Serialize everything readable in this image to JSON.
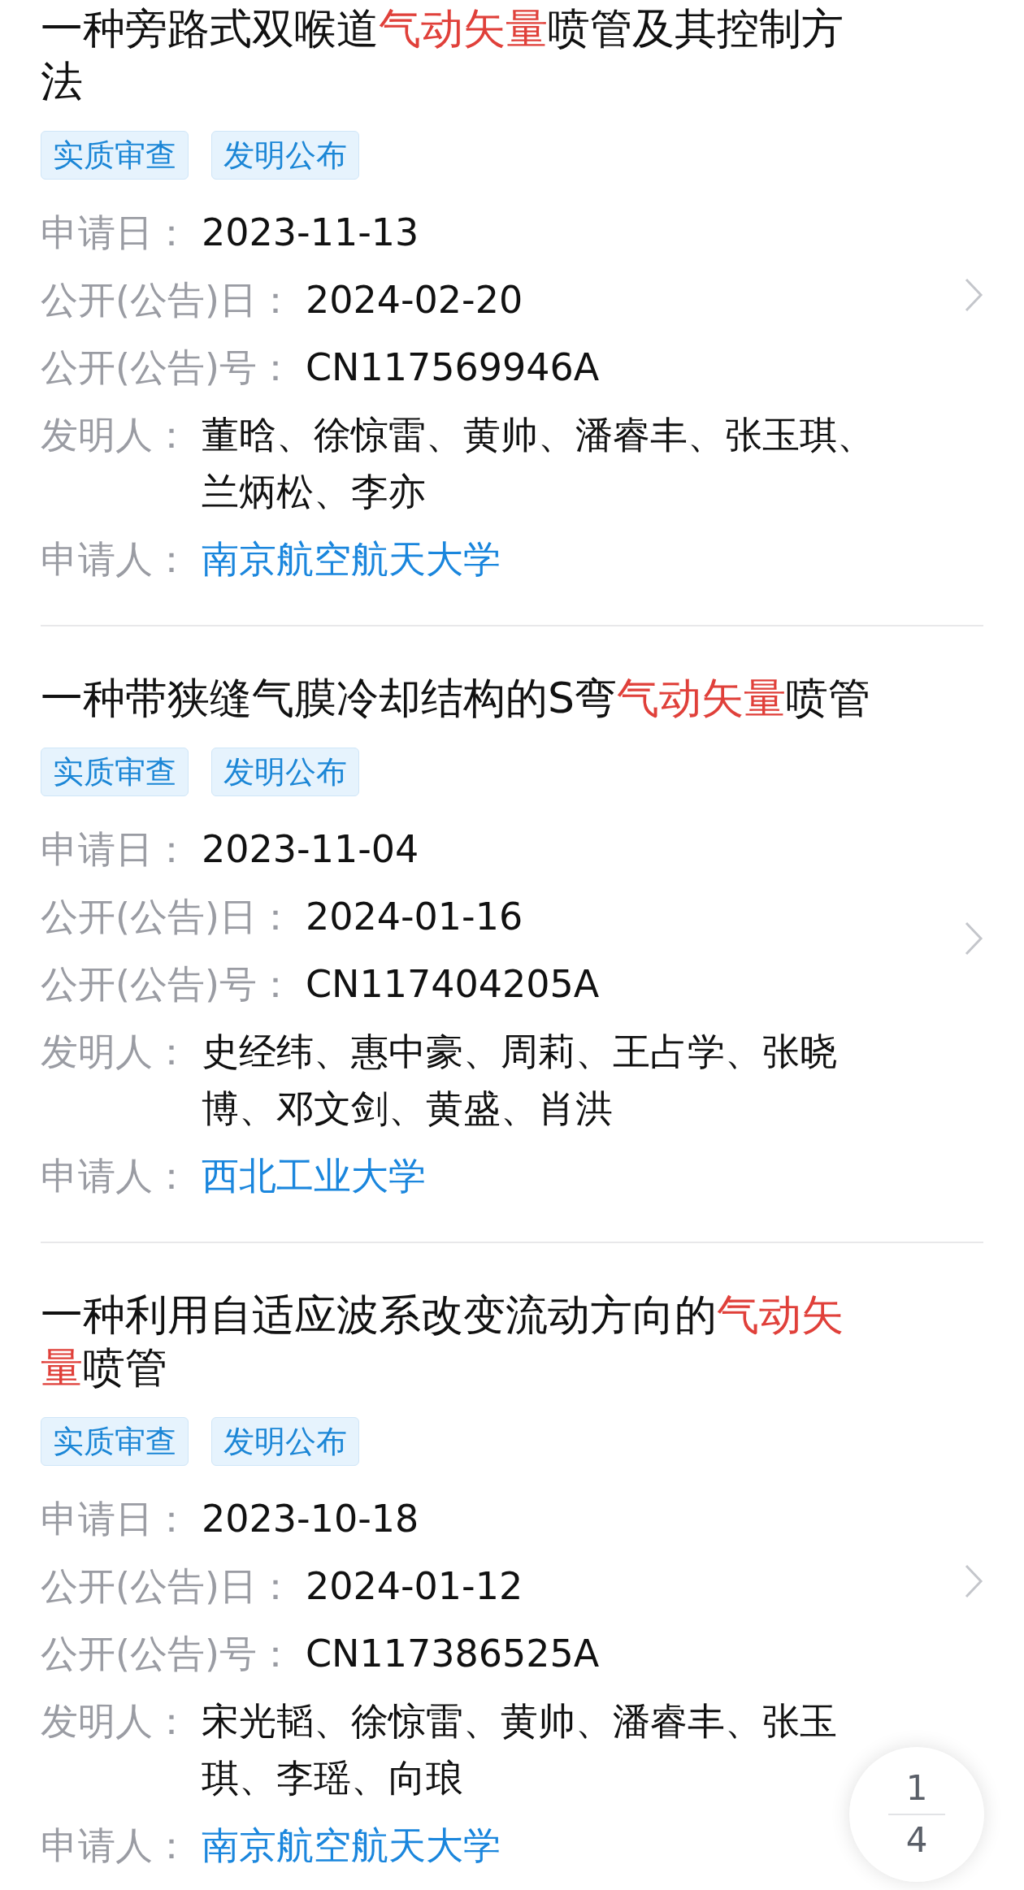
{
  "patents": [
    {
      "title": [
        {
          "text": "一种旁路式双喉道",
          "highlighted": false
        },
        {
          "text": "气动矢量",
          "highlighted": true
        },
        {
          "text": "喷管及其控制方法",
          "highlighted": false
        }
      ],
      "tags": [
        "实质审查",
        "发明公布"
      ],
      "fields": [
        {
          "label": "申请日：",
          "value": "2023-11-13",
          "kind": "plain"
        },
        {
          "label": "公开(公告)日：",
          "value": "2024-02-20",
          "kind": "plain"
        },
        {
          "label": "公开(公告)号：",
          "value": "CN117569946A",
          "kind": "plain"
        },
        {
          "label": "发明人：",
          "value": "董晗、徐惊雷、黄帅、潘睿丰、张玉琪、兰炳松、李亦",
          "kind": "plain"
        },
        {
          "label": "申请人：",
          "value": "南京航空航天大学",
          "kind": "link"
        }
      ]
    },
    {
      "title": [
        {
          "text": "一种带狭缝气膜冷却结构的S弯",
          "highlighted": false
        },
        {
          "text": "气动矢量",
          "highlighted": true
        },
        {
          "text": "喷管",
          "highlighted": false
        }
      ],
      "tags": [
        "实质审查",
        "发明公布"
      ],
      "fields": [
        {
          "label": "申请日：",
          "value": "2023-11-04",
          "kind": "plain"
        },
        {
          "label": "公开(公告)日：",
          "value": "2024-01-16",
          "kind": "plain"
        },
        {
          "label": "公开(公告)号：",
          "value": "CN117404205A",
          "kind": "plain"
        },
        {
          "label": "发明人：",
          "value": "史经纬、惠中豪、周莉、王占学、张晓博、邓文剑、黄盛、肖洪",
          "kind": "plain"
        },
        {
          "label": "申请人：",
          "value": "西北工业大学",
          "kind": "link"
        }
      ]
    },
    {
      "title": [
        {
          "text": "一种利用自适应波系改变流动方向的",
          "highlighted": false
        },
        {
          "text": "气动矢量",
          "highlighted": true
        },
        {
          "text": "喷管",
          "highlighted": false
        }
      ],
      "tags": [
        "实质审查",
        "发明公布"
      ],
      "fields": [
        {
          "label": "申请日：",
          "value": "2023-10-18",
          "kind": "plain"
        },
        {
          "label": "公开(公告)日：",
          "value": "2024-01-12",
          "kind": "plain"
        },
        {
          "label": "公开(公告)号：",
          "value": "CN117386525A",
          "kind": "plain"
        },
        {
          "label": "发明人：",
          "value": "宋光韬、徐惊雷、黄帅、潘睿丰、张玉琪、李瑶、向琅",
          "kind": "plain"
        },
        {
          "label": "申请人：",
          "value": "南京航空航天大学",
          "kind": "link"
        }
      ]
    }
  ],
  "page_indicator": {
    "current": "1",
    "total": "4"
  }
}
